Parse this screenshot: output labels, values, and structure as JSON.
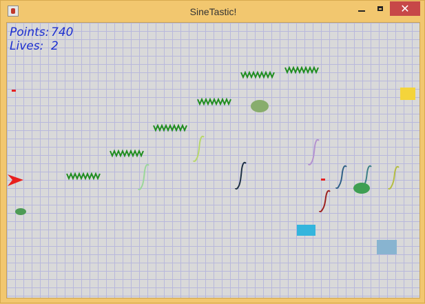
{
  "window": {
    "title": "SineTastic!"
  },
  "hud": {
    "points_label": "Points:",
    "points_value": "740",
    "lives_label": "Lives:",
    "lives_value": "2"
  },
  "colors": {
    "grid": "#b8b8dc",
    "background": "#d9d9d9",
    "frame": "#f2c76f",
    "zigzag": "#1f8d1f",
    "player": "#e8201e",
    "score_text": "#1c2fd0"
  },
  "entities": {
    "player": {
      "name": "player-ship",
      "color": "#e8201e"
    },
    "zigzags": [
      "#1f8d1f",
      "#1f8d1f",
      "#1f8d1f",
      "#1f8d1f",
      "#1f8d1f",
      "#1f8d1f"
    ],
    "integrals": [
      "#b7d76a",
      "#9bd79a",
      "#1d2f44",
      "#b492cf",
      "#2f5f86",
      "#3b7f86",
      "#b4bd42",
      "#9c1f1f"
    ],
    "blobs": [
      "#88ad6d",
      "#3f9f52",
      "#4d9b55"
    ],
    "squares": [
      "#f4d43b",
      "#33b5dd",
      "#88b4d0"
    ],
    "bullets": [
      "#e62020",
      "#e62020"
    ]
  }
}
